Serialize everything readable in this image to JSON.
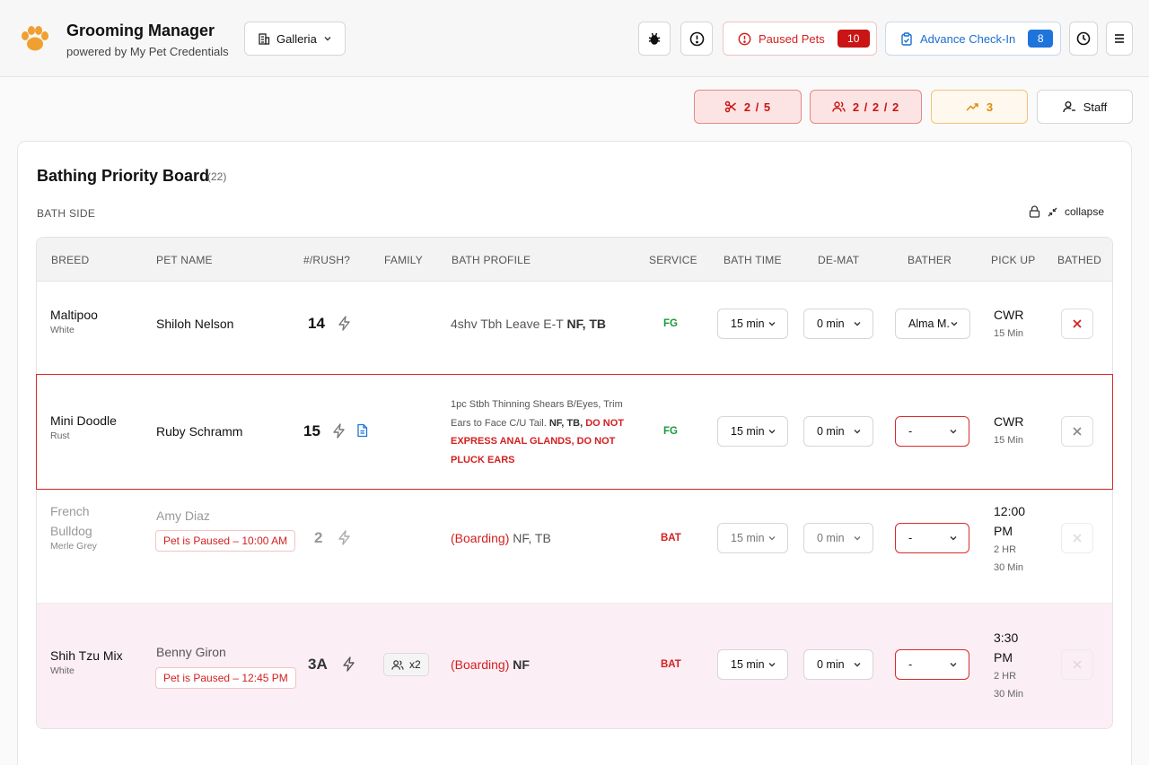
{
  "header": {
    "app_title": "Grooming Manager",
    "app_subtitle": "powered by My Pet Credentials",
    "location": "Galleria",
    "paused_label": "Paused Pets",
    "paused_count": "10",
    "checkin_label": "Advance Check-In",
    "checkin_count": "8"
  },
  "stats": {
    "groom": "2 / 5",
    "bath": "2 / 2 / 2",
    "trend": "3",
    "staff_label": "Staff"
  },
  "board": {
    "title": "Bathing Priority Board",
    "count": "(22)",
    "section": "BATH SIDE",
    "collapse_label": "collapse"
  },
  "table": {
    "headers": [
      "BREED",
      "PET NAME",
      "#/RUSH?",
      "FAMILY",
      "BATH PROFILE",
      "SERVICE",
      "BATH TIME",
      "DE-MAT",
      "BATHER",
      "PICK UP",
      "BATHED"
    ],
    "rows": [
      {
        "breed": "Maltipoo",
        "color": "White",
        "pet": "Shiloh Nelson",
        "number": "14",
        "profile_plain": "4shv Tbh Leave E-T ",
        "profile_bold": "NF, TB",
        "service": "FG",
        "bath_time": "15 min",
        "dematt": "0 min",
        "bather": "Alma M.",
        "pickup": "CWR",
        "pickup_sub": "15 Min"
      },
      {
        "breed": "Mini Doodle",
        "color": "Rust",
        "pet": "Ruby Schramm",
        "number": "15",
        "profile_plain": "1pc Stbh Thinning Shears B/Eyes, Trim Ears to Face C/U Tail. ",
        "profile_bold": "NF, TB, ",
        "profile_warn": "DO NOT EXPRESS ANAL GLANDS, DO NOT PLUCK EARS",
        "service": "FG",
        "bath_time": "15 min",
        "dematt": "0 min",
        "bather": "-",
        "pickup": "CWR",
        "pickup_sub": "15 Min"
      },
      {
        "breed_line1": "French",
        "breed_line2": "Bulldog",
        "color": "Merle Grey",
        "pet": "Amy Diaz",
        "paused": "Pet is Paused – 10:00 AM",
        "number": "2",
        "profile_red": "(Boarding)",
        "profile_rest": " NF, TB",
        "service": "BAT",
        "bath_time": "15 min",
        "dematt": "0 min",
        "bather": "-",
        "pickup_line1": "12:00",
        "pickup_line2": "PM",
        "pickup_sub1": "2 HR",
        "pickup_sub2": "30 Min"
      },
      {
        "breed": "Shih Tzu Mix",
        "color": "White",
        "pet": "Benny Giron",
        "paused": "Pet is Paused – 12:45 PM",
        "number": "3A",
        "family": "x2",
        "profile_red": "(Boarding)",
        "profile_rest": " NF",
        "service": "BAT",
        "bath_time": "15 min",
        "dematt": "0 min",
        "bather": "-",
        "pickup_line1": "3:30",
        "pickup_line2": "PM",
        "pickup_sub1": "2 HR",
        "pickup_sub2": "30 Min"
      }
    ]
  },
  "icons": {
    "logo": "paw-icon",
    "location": "building-icon",
    "bug": "bug-icon",
    "alert": "alert-circle-icon",
    "checkin": "clipboard-check-icon",
    "history": "clock-icon",
    "menu": "menu-icon",
    "groom": "scissors-icon",
    "bath": "users-icon",
    "trend": "trending-up-icon",
    "staff": "user-icon",
    "lock": "lock-icon",
    "collapse": "collapse-arrows-icon",
    "rush": "bolt-icon",
    "notes": "document-icon",
    "bathed": "x-icon"
  },
  "colors": {
    "accent_red": "#d32020",
    "accent_blue": "#1f74dc",
    "service_fg": "#1a9a3a",
    "paused_row_bg": "#fbeef4",
    "trend_orange": "#e08a10",
    "logo_orange": "#f0a030"
  }
}
